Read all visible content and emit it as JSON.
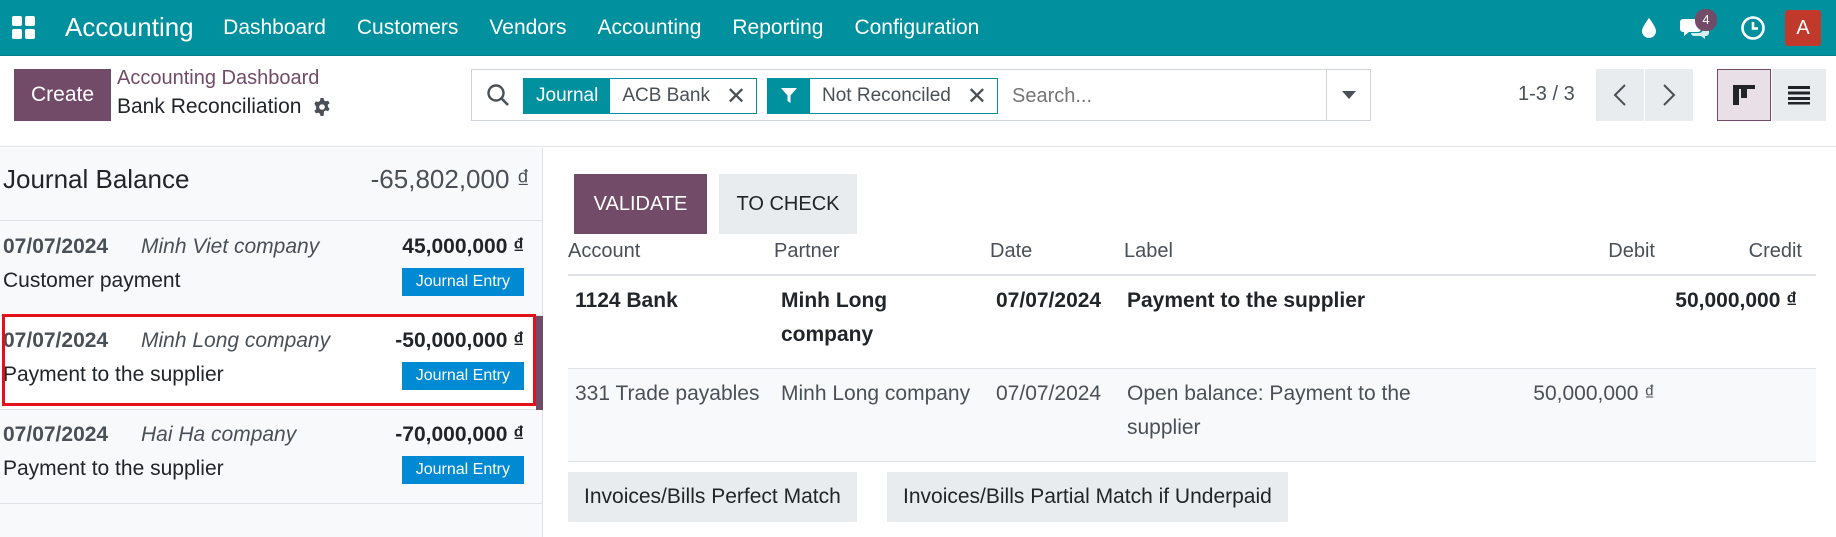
{
  "navbar": {
    "app_name": "Accounting",
    "menu": [
      "Dashboard",
      "Customers",
      "Vendors",
      "Accounting",
      "Reporting",
      "Configuration"
    ],
    "messages_count": "4",
    "user_initial": "A",
    "icons": [
      "apps-grid-icon",
      "water-drop-icon",
      "chat-icon",
      "clock-icon"
    ]
  },
  "control_panel": {
    "create_label": "Create",
    "breadcrumb_parent": "Accounting Dashboard",
    "breadcrumb_current": "Bank Reconciliation",
    "facets": [
      {
        "category": "Journal",
        "value": "ACB Bank"
      },
      {
        "category_icon": "filter-icon",
        "value": "Not Reconciled"
      }
    ],
    "search_placeholder": "Search...",
    "pager": "1-3 / 3"
  },
  "left": {
    "balance_label": "Journal Balance",
    "balance_value": "-65,802,000 ₫",
    "lines": [
      {
        "date": "07/07/2024",
        "partner": "Minh Viet company",
        "amount": "45,000,000 ₫",
        "label": "Customer payment",
        "je_label": "Journal Entry"
      },
      {
        "date": "07/07/2024",
        "partner": "Minh Long company",
        "amount": "-50,000,000 ₫",
        "label": "Payment to the supplier",
        "je_label": "Journal Entry"
      },
      {
        "date": "07/07/2024",
        "partner": "Hai Ha company",
        "amount": "-70,000,000 ₫",
        "label": "Payment to the supplier",
        "je_label": "Journal Entry"
      }
    ]
  },
  "right": {
    "validate_label": "VALIDATE",
    "to_check_label": "TO CHECK",
    "columns": {
      "account": "Account",
      "partner": "Partner",
      "date": "Date",
      "label": "Label",
      "debit": "Debit",
      "credit": "Credit"
    },
    "rows": [
      {
        "account": "1124 Bank",
        "partner": "Minh Long company",
        "date": "07/07/2024",
        "label": "Payment to the supplier",
        "debit": "",
        "credit": "50,000,000 ₫"
      },
      {
        "account": "331 Trade payables",
        "partner": "Minh Long company",
        "date": "07/07/2024",
        "label": "Open balance: Payment to the supplier",
        "debit": "50,000,000 ₫",
        "credit": ""
      }
    ],
    "models": [
      "Invoices/Bills Perfect Match",
      "Invoices/Bills Partial Match if Underpaid"
    ]
  },
  "colors": {
    "navbar": "#00909e",
    "primary": "#714b67",
    "journal_entry_button": "#008ad3",
    "highlight": "#e3111b"
  }
}
